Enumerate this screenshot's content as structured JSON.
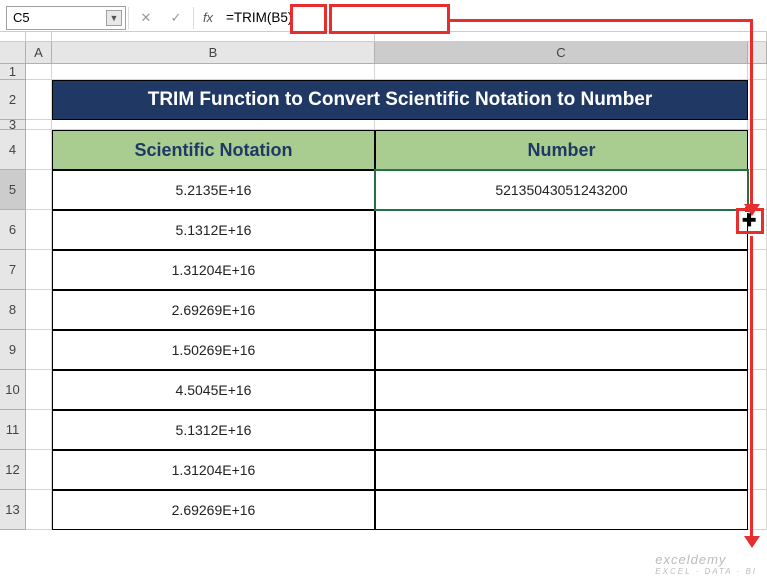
{
  "nameBox": {
    "value": "C5"
  },
  "formulaBar": {
    "fxLabel": "fx",
    "formula": "=TRIM(B5)"
  },
  "columns": {
    "A": "A",
    "B": "B",
    "C": "C"
  },
  "rows": [
    "1",
    "2",
    "3",
    "4",
    "5",
    "6",
    "7",
    "8",
    "9",
    "10",
    "11",
    "12",
    "13"
  ],
  "title": "TRIM Function to Convert Scientific Notation to Number",
  "headers": {
    "b": "Scientific Notation",
    "c": "Number"
  },
  "data": [
    {
      "sci": "5.2135E+16",
      "num": "52135043051243200"
    },
    {
      "sci": "5.1312E+16",
      "num": ""
    },
    {
      "sci": "1.31204E+16",
      "num": ""
    },
    {
      "sci": "2.69269E+16",
      "num": ""
    },
    {
      "sci": "1.50269E+16",
      "num": ""
    },
    {
      "sci": "4.5045E+16",
      "num": ""
    },
    {
      "sci": "5.1312E+16",
      "num": ""
    },
    {
      "sci": "1.31204E+16",
      "num": ""
    },
    {
      "sci": "2.69269E+16",
      "num": ""
    }
  ],
  "watermark": {
    "main": "exceldemy",
    "sub": "EXCEL · DATA · BI"
  }
}
